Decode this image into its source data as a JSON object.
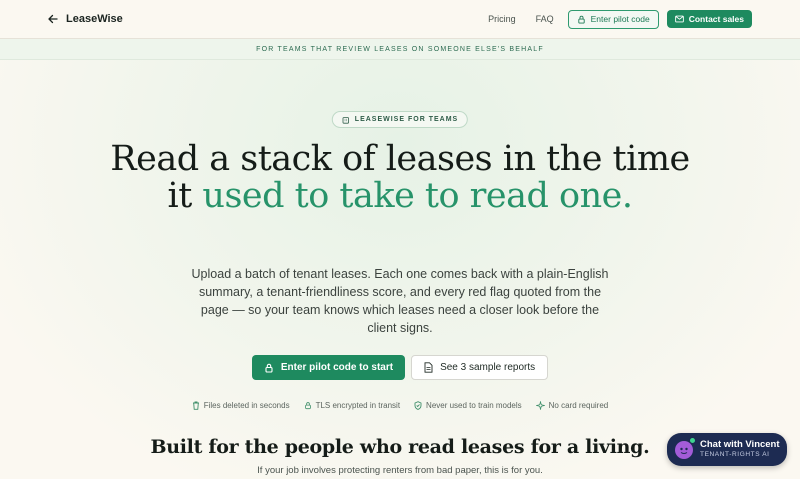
{
  "nav": {
    "brand": "LeaseWise",
    "links": [
      "Pricing",
      "FAQ"
    ],
    "pilot_button": "Enter pilot code",
    "sales_button": "Contact sales"
  },
  "strip": {
    "text": "FOR TEAMS THAT REVIEW LEASES ON SOMEONE ELSE'S BEHALF"
  },
  "hero": {
    "pill": "LEASEWISE FOR TEAMS",
    "headline_plain_1": "Read a stack of leases in the time it",
    "headline_accent": "used to take to read one.",
    "subtext": "Upload a batch of tenant leases. Each one comes back with a plain-English summary, a tenant-friendliness score, and every red flag quoted from the page — so your team knows which leases need a closer look before the client signs.",
    "cta_primary": "Enter pilot code to start",
    "cta_secondary": "See 3 sample reports",
    "trust": [
      {
        "icon": "trash-icon",
        "label": "Files deleted in seconds"
      },
      {
        "icon": "lock-icon",
        "label": "TLS encrypted in transit"
      },
      {
        "icon": "shield-check-icon",
        "label": "Never used to train models"
      },
      {
        "icon": "sparkle-icon",
        "label": "No card required"
      }
    ]
  },
  "section": {
    "title": "Built for the people who read leases for a living.",
    "subtitle": "If your job involves protecting renters from bad paper, this is for you."
  },
  "chat": {
    "title": "Chat with Vincent",
    "subtitle": "TENANT-RIGHTS AI"
  },
  "colors": {
    "accent": "#27936a",
    "button": "#1e8a5f",
    "chat_bg": "#1d2b52"
  }
}
